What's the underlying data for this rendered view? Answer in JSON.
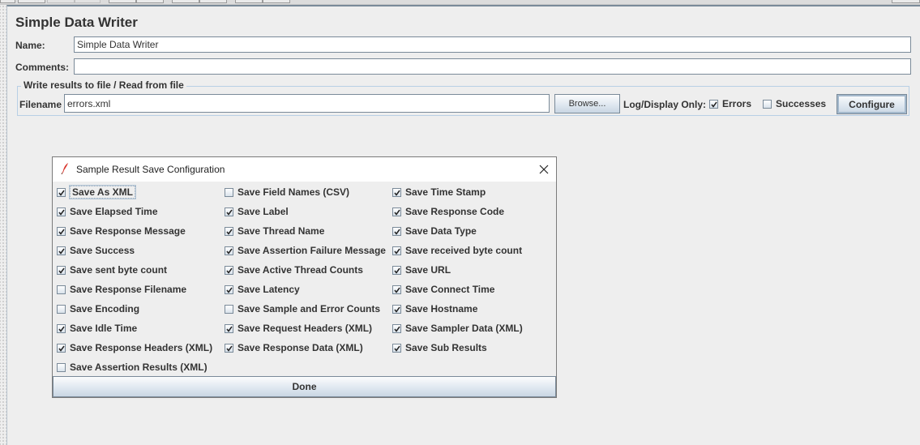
{
  "panel": {
    "title": "Simple Data Writer",
    "name_label": "Name:",
    "name_value": "Simple Data Writer",
    "comments_label": "Comments:",
    "comments_value": "",
    "file_section": {
      "legend": "Write results to file / Read from file",
      "filename_label": "Filename",
      "filename_value": "errors.xml",
      "browse_label": "Browse...",
      "log_display_label": "Log/Display Only:",
      "errors_label": "Errors",
      "errors_checked": true,
      "successes_label": "Successes",
      "successes_checked": false,
      "configure_label": "Configure"
    }
  },
  "dialog": {
    "title": "Sample Result Save Configuration",
    "icon": "feather-icon",
    "close_icon": "close-icon",
    "done_label": "Done",
    "columns": [
      [
        {
          "label": "Save As XML",
          "checked": true,
          "focused": true
        },
        {
          "label": "Save Elapsed Time",
          "checked": true
        },
        {
          "label": "Save Response Message",
          "checked": true
        },
        {
          "label": "Save Success",
          "checked": true
        },
        {
          "label": "Save sent byte count",
          "checked": true
        },
        {
          "label": "Save Response Filename",
          "checked": false
        },
        {
          "label": "Save Encoding",
          "checked": false
        },
        {
          "label": "Save Idle Time",
          "checked": true
        },
        {
          "label": "Save Response Headers (XML)",
          "checked": true
        },
        {
          "label": "Save Assertion Results (XML)",
          "checked": false
        }
      ],
      [
        {
          "label": "Save Field Names (CSV)",
          "checked": false
        },
        {
          "label": "Save Label",
          "checked": true
        },
        {
          "label": "Save Thread Name",
          "checked": true
        },
        {
          "label": "Save Assertion Failure Message",
          "checked": true
        },
        {
          "label": "Save Active Thread Counts",
          "checked": true
        },
        {
          "label": "Save Latency",
          "checked": true
        },
        {
          "label": "Save Sample and Error Counts",
          "checked": false
        },
        {
          "label": "Save Request Headers (XML)",
          "checked": true
        },
        {
          "label": "Save Response Data (XML)",
          "checked": true
        }
      ],
      [
        {
          "label": "Save Time Stamp",
          "checked": true
        },
        {
          "label": "Save Response Code",
          "checked": true
        },
        {
          "label": "Save Data Type",
          "checked": true
        },
        {
          "label": "Save received byte count",
          "checked": true
        },
        {
          "label": "Save URL",
          "checked": true
        },
        {
          "label": "Save Connect Time",
          "checked": true
        },
        {
          "label": "Save Hostname",
          "checked": true
        },
        {
          "label": "Save Sampler Data (XML)",
          "checked": true
        },
        {
          "label": "Save Sub Results",
          "checked": true
        }
      ]
    ]
  }
}
